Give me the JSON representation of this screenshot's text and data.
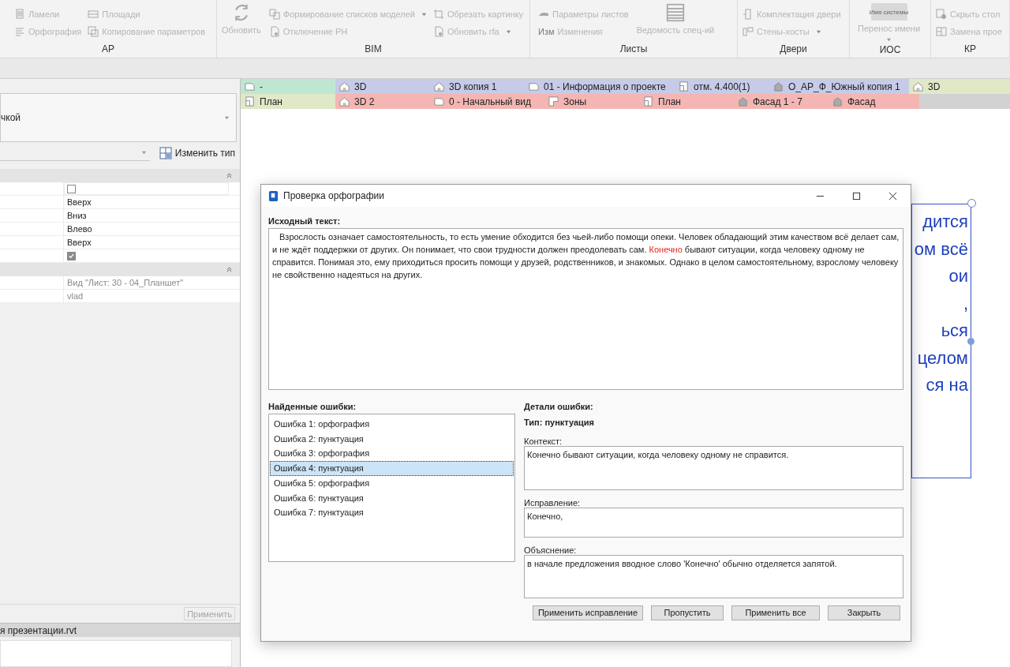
{
  "ribbon": {
    "panels": [
      {
        "label": "АР",
        "columns": [
          [
            {
              "label": "Ламели"
            },
            {
              "label": "Орфография"
            }
          ],
          [
            {
              "label": "Площади"
            },
            {
              "label": "Копирование параметров"
            }
          ]
        ]
      },
      {
        "label": "BIM",
        "big": {
          "label": "Обновить"
        },
        "columns": [
          [
            {
              "label": "Формирование списков моделей",
              "dropdown": true
            },
            {
              "label": "Отключение РН"
            }
          ],
          [
            {
              "label": "Обрезать картинку"
            },
            {
              "label": "Обновить rfa",
              "dropdown": true
            }
          ]
        ]
      },
      {
        "label": "Листы",
        "columns": [
          [
            {
              "label": "Параметры листов"
            },
            {
              "label": "Изменения",
              "icon_label": "Изм"
            }
          ]
        ],
        "big": {
          "label": "Ведомость спец-ий"
        }
      },
      {
        "label": "Двери",
        "columns": [
          [
            {
              "label": "Комплектация двери"
            },
            {
              "label": "Стены-хосты",
              "dropdown": true
            }
          ]
        ]
      },
      {
        "label": "ИОС",
        "big": {
          "label": "Перенос имени",
          "icon_label": "Имя системы",
          "dropdown": true
        }
      },
      {
        "label": "КР",
        "columns": [
          [
            {
              "label": "Скрыть стол"
            },
            {
              "label": "Замена прое"
            }
          ]
        ]
      }
    ]
  },
  "view_tabs": [
    [
      {
        "label": "-",
        "kind": "sheet",
        "color": "#bfe6d3"
      },
      {
        "label": "3D",
        "kind": "view3d",
        "color": "#c6cbe8"
      },
      {
        "label": "3D копия 1",
        "kind": "view3d",
        "color": "#c6cbe8"
      },
      {
        "label": "01 - Информация о проекте",
        "kind": "sheet",
        "color": "#c6cbe8"
      },
      {
        "label": "отм. 4.400(1)",
        "kind": "plan",
        "color": "#c6cbe8"
      },
      {
        "label": "О_АР_Ф_Южный копия 1",
        "kind": "elevation",
        "color": "#c6cbe8"
      },
      {
        "label": "3D",
        "kind": "view3d",
        "color": "#dfe9c7"
      }
    ],
    [
      {
        "label": "План",
        "kind": "plan",
        "color": "#dfe9c7"
      },
      {
        "label": "3D 2",
        "kind": "view3d",
        "color": "#f4b6b3"
      },
      {
        "label": "0 - Начальный вид",
        "kind": "sheet",
        "color": "#f4b6b3"
      },
      {
        "label": "Зоны",
        "kind": "zone",
        "color": "#f4b6b3"
      },
      {
        "label": "План",
        "kind": "plan",
        "color": "#f4b6b3"
      },
      {
        "label": "Фасад 1 - 7",
        "kind": "elevation",
        "color": "#f4b6b3"
      },
      {
        "label": "Фасад",
        "kind": "elevation",
        "color": "#f4b6b3"
      }
    ]
  ],
  "properties": {
    "type_selector": "чкой",
    "edit_type": "Изменить тип",
    "sections": [
      {
        "rows": [
          {
            "kind": "checkbox",
            "checked": false,
            "selected": true
          },
          {
            "kind": "text",
            "value": "Вверх",
            "selected": false
          },
          {
            "kind": "text",
            "value": "Вниз",
            "selected": false
          },
          {
            "kind": "text",
            "value": "Влево",
            "selected": false
          },
          {
            "kind": "text",
            "value": "Вверх",
            "selected": false
          },
          {
            "kind": "checkbox",
            "checked": true,
            "selected": false
          }
        ]
      },
      {
        "rows": [
          {
            "kind": "readonly",
            "value": "Вид \"Лист: 30 - 04_Планшет\"",
            "selected": false
          },
          {
            "kind": "readonly",
            "value": "vlad",
            "selected": false
          }
        ]
      }
    ],
    "apply": "Применить"
  },
  "project_browser": {
    "title": "я презентации.rvt"
  },
  "canvas_text": [
    "дится",
    "ом всё",
    "ои",
    ",",
    "ься",
    "целом",
    "ся на"
  ],
  "dialog": {
    "title": "Проверка орфографии",
    "source_label": "Исходный текст:",
    "source_text": [
      {
        "text": "Взрослость означает самостоятельность, то есть умение обходится без чьей-либо помощи опеки. Человек обладающий этим качеством всё делает сам, и не ждёт поддержки от других. Он понимает, что свои трудности должен преодолевать сам. ",
        "highlight": false
      },
      {
        "text": "Конечно",
        "highlight": true
      },
      {
        "text": " бывают ситуации, когда человеку одному не справится. Понимая это, ему приходиться просить помощи у друзей, родственников, и знакомых. Однако в целом самостоятельному, взрослому человеку не свойственно надеяться на других.",
        "highlight": false
      }
    ],
    "errors_label": "Найденные ошибки:",
    "errors": [
      {
        "label": "Ошибка 1: орфография",
        "selected": false
      },
      {
        "label": "Ошибка 2: пунктуация",
        "selected": false
      },
      {
        "label": "Ошибка 3: орфография",
        "selected": false
      },
      {
        "label": "Ошибка 4: пунктуация",
        "selected": true
      },
      {
        "label": "Ошибка 5: орфография",
        "selected": false
      },
      {
        "label": "Ошибка 6: пунктуация",
        "selected": false
      },
      {
        "label": "Ошибка 7: пунктуация",
        "selected": false
      }
    ],
    "details_label": "Детали ошибки:",
    "type": "Тип: пунктуация",
    "context_label": "Контекст:",
    "context": "Конечно бывают ситуации, когда человеку одному не справится.",
    "correction_label": "Исправление:",
    "correction": "Конечно,",
    "explanation_label": "Объяснение:",
    "explanation": "в начале предложения вводное слово 'Конечно' обычно отделяется запятой.",
    "buttons": [
      "Применить исправление",
      "Пропустить",
      "Применить все",
      "Закрыть"
    ]
  }
}
